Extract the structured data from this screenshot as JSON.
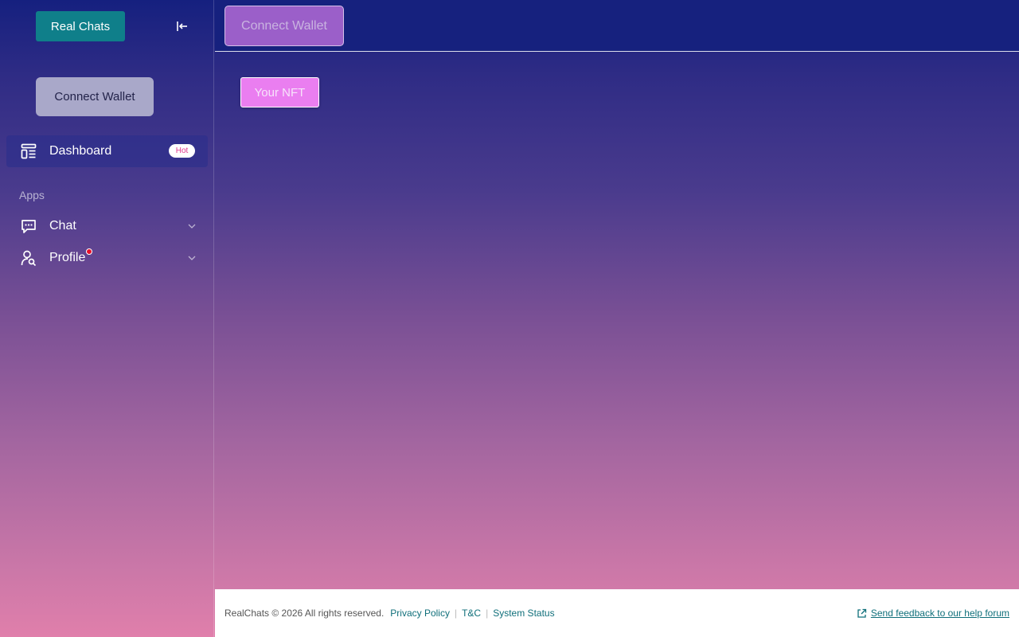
{
  "sidebar": {
    "brand_label": "Real Chats",
    "connect_wallet_label": "Connect Wallet",
    "items": [
      {
        "label": "Dashboard",
        "icon": "dashboard-icon",
        "badge": "Hot",
        "active": true
      },
      {
        "label": "Chat",
        "icon": "chat-icon"
      },
      {
        "label": "Profile",
        "icon": "profile-search-icon",
        "has_notification": true
      }
    ],
    "section_label": "Apps"
  },
  "header": {
    "connect_wallet_label": "Connect Wallet"
  },
  "main": {
    "nft_button_label": "Your NFT"
  },
  "footer": {
    "copyright": "RealChats © 2026 All rights reserved.",
    "links": [
      "Privacy Policy",
      "T&C",
      "System Status"
    ],
    "feedback_label": "Send feedback to our help forum"
  },
  "colors": {
    "brand": "#0f7f8a",
    "header_bg": "#16217e",
    "nft_button": "#ea7ef0",
    "badge_text": "#e0368c",
    "notification_dot": "#e8102a"
  }
}
